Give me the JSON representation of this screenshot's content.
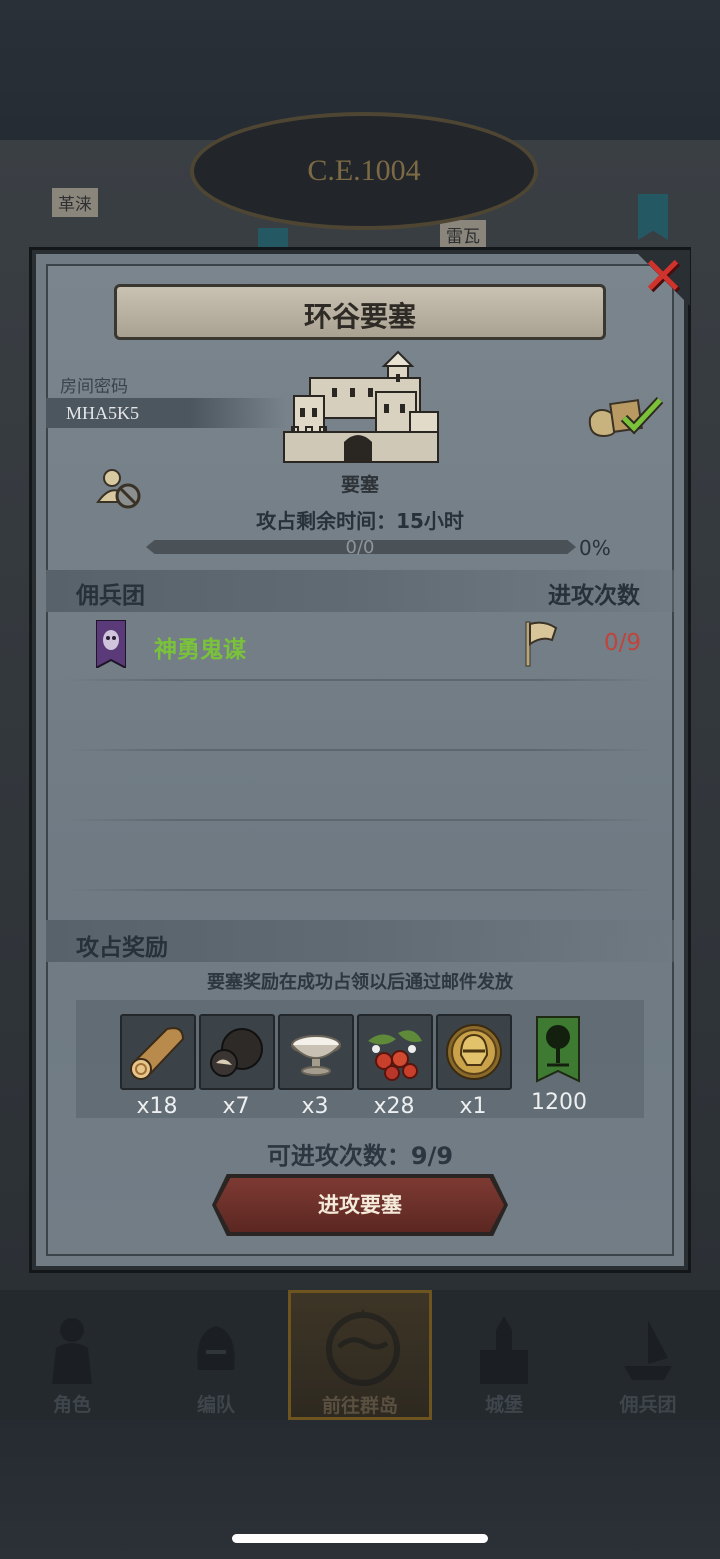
{
  "background": {
    "era": "C.E.1004",
    "map_labels": [
      "革涞",
      "雷瓦"
    ]
  },
  "dialog": {
    "title": "环谷要塞",
    "room_code_label": "房间密码",
    "room_code": "MHA5K5",
    "building_type": "要塞",
    "time_remaining": "攻占剩余时间：15小时",
    "progress": {
      "text": "0/0",
      "percent": "0%",
      "fraction": 0
    },
    "mercenary_header": "佣兵团",
    "attack_count_header": "进攻次数",
    "mercenaries": [
      {
        "name": "神勇鬼谋",
        "attacks": "0/9"
      }
    ],
    "rewards_header": "攻占奖励",
    "rewards_note": "要塞奖励在成功占领以后通过邮件发放",
    "rewards": [
      {
        "icon": "wood-log-icon",
        "qty": "x18"
      },
      {
        "icon": "truffle-icon",
        "qty": "x7"
      },
      {
        "icon": "silver-bowl-icon",
        "qty": "x3"
      },
      {
        "icon": "berries-icon",
        "qty": "x28"
      },
      {
        "icon": "golden-helmet-icon",
        "qty": "x1"
      },
      {
        "icon": "tree-banner-icon",
        "qty": "1200"
      }
    ],
    "attacks_available": "可进攻次数：9/9",
    "attack_button": "进攻要塞"
  },
  "nav": {
    "items": [
      {
        "label": "角色",
        "icon": "knight-icon"
      },
      {
        "label": "编队",
        "icon": "helmet-icon"
      },
      {
        "label": "前往群岛",
        "icon": "compass-map-icon",
        "active": true
      },
      {
        "label": "城堡",
        "icon": "castle-icon"
      },
      {
        "label": "佣兵团",
        "icon": "ship-icon"
      }
    ]
  },
  "colors": {
    "merc_name": "#7ac23a",
    "attack_count": "#c0443c",
    "close": "#d0322c",
    "button": "#6b2f28"
  }
}
